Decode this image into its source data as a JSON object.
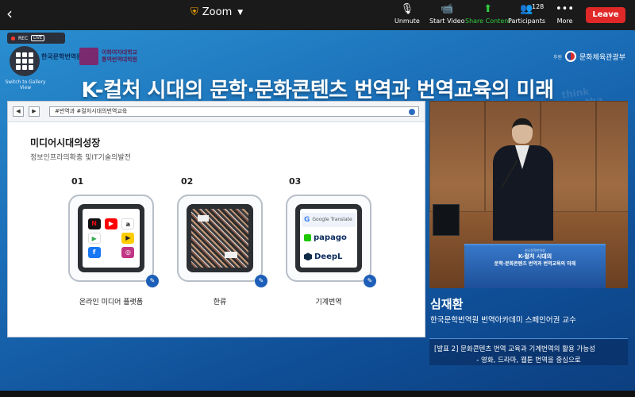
{
  "toolbar": {
    "back_icon": "chevron-left-icon",
    "app_title": "Zoom",
    "security_icon": "shield-icon",
    "unmute_label": "Unmute",
    "start_video_label": "Start Video",
    "share_content_label": "Share Content",
    "participants_label": "Participants",
    "participants_count": "128",
    "more_label": "More",
    "leave_label": "Leave",
    "leave_color": "#e02828",
    "share_color": "#2ecc40"
  },
  "meeting": {
    "rec_label": "REC",
    "live_label": "LIVE",
    "gallery_label": "Switch to Gallery View"
  },
  "event": {
    "host_logo_text": "한국문학번역원",
    "ewha_line1": "이화여자대학교",
    "ewha_line2": "통역번역대학원",
    "sponsor_prefix": "후원",
    "sponsor_name": "문화체육관광부",
    "title": "K-컬처 시대의 문학·문화콘텐츠 번역과 번역교육의 미래"
  },
  "slide": {
    "url_text": "#번역과 #컬처시대의번역교육",
    "heading": "미디어시대의성장",
    "subheading": "정보인프라의확충 및IT기술의발전",
    "cards": [
      {
        "num": "01",
        "label": "온라인 미디어 플랫폼"
      },
      {
        "num": "02",
        "label": "한류"
      },
      {
        "num": "03",
        "label": "기계번역"
      }
    ],
    "mt_google": "Google Translate",
    "mt_papago": "papago",
    "mt_deepl": "DeepL"
  },
  "speaker": {
    "name": "심재환",
    "affiliation": "한국문학번역원 번역아카데미 스페인어권 교수",
    "talk_line1": "[발표 2] 문화콘텐츠 번역 교육과 기계번역의 활용 가능성",
    "talk_line2": "- 영화, 드라마, 웹툰 번역을 중심으로",
    "podium_line1": "K-컬처 시대의",
    "podium_line2": "문학·문화콘텐츠 번역과 번역교육의 미래"
  }
}
